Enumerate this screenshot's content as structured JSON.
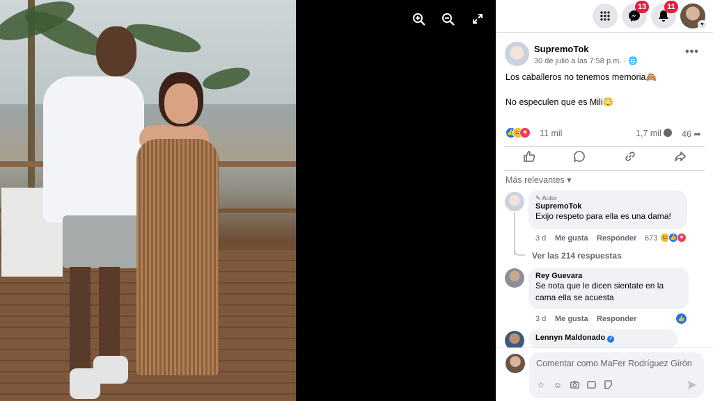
{
  "viewer": {
    "zoom_in_icon": "zoom-in-icon",
    "zoom_out_icon": "zoom-out-icon",
    "fullscreen_icon": "fullscreen-icon"
  },
  "topbar": {
    "menu_icon": "grid-menu-icon",
    "messenger_badge": "13",
    "notifications_badge": "11"
  },
  "post": {
    "author": "SupremoTok",
    "meta": "30 de julio a las 7:58 p.m. · 🌐",
    "line1": "Los caballeros no tenemos memoria🙈",
    "line2": "No especulen que es Mili😳",
    "reactions_count": "11 mil",
    "comments_count": "1,7 mil",
    "shares_count": "46"
  },
  "actions": {
    "like_icon": "like-icon",
    "comment_icon": "comment-icon",
    "send_icon": "send-link-icon",
    "share_icon": "share-icon"
  },
  "comments": {
    "sort_label": "Más relevantes ▾",
    "items": [
      {
        "tag": "✎ Autor",
        "name": "SupremoTok",
        "text": "Exijo respeto para ella es una dama!",
        "time": "3 d",
        "like_label": "Me gusta",
        "reply_label": "Responder",
        "reaction_count": "673"
      },
      {
        "name": "Rey Guevara",
        "text": "Se nota que le dicen sientate en la cama ella se acuesta",
        "time": "3 d",
        "like_label": "Me gusta",
        "reply_label": "Responder"
      },
      {
        "name": "Lennyn Maldonado"
      }
    ],
    "view_replies": "Ver las 214 respuestas"
  },
  "composer": {
    "placeholder": "Comentar como MaFer Rodríguez Girón"
  },
  "colors": {
    "accent": "#1877f2",
    "badge": "#e41e3f",
    "love": "#f33e58",
    "haha": "#f7b928"
  }
}
